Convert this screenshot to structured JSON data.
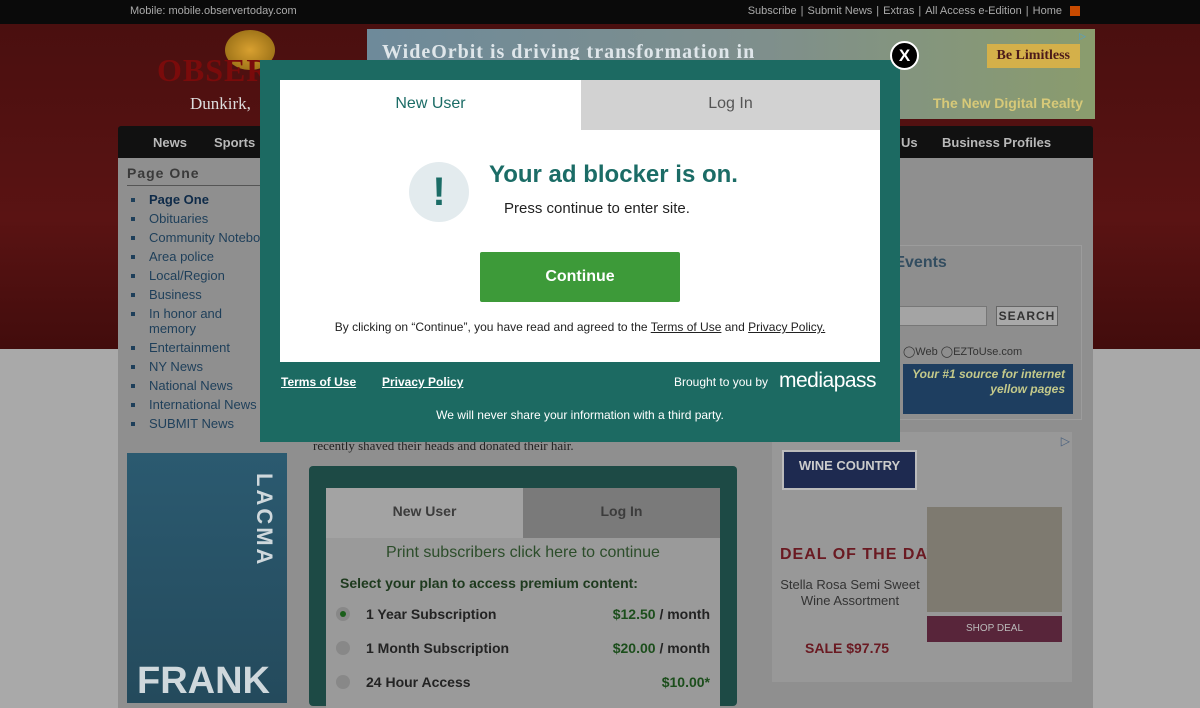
{
  "topbar": {
    "mobile": "Mobile: mobile.observertoday.com",
    "links": [
      "Subscribe",
      "|",
      "Submit News",
      "|",
      "Extras",
      "|",
      "All Access e-Edition",
      "|",
      "Home"
    ]
  },
  "logo": {
    "name": "OBSER",
    "city": "Dunkirk,"
  },
  "banner": {
    "headline": "WideOrbit is driving transformation in",
    "button": "Be Limitless",
    "tagline": "The New Digital Realty"
  },
  "nav": {
    "items": [
      "News",
      "Sports",
      "Us",
      "Business Profiles"
    ]
  },
  "sidebar": {
    "title": "Page One",
    "items": [
      "Page One",
      "Obituaries",
      "Community Notebook",
      "Area police",
      "Local/Region",
      "Business",
      "In honor and memory",
      "Entertainment",
      "NY News",
      "National News",
      "International News",
      "SUBMIT News"
    ]
  },
  "lacma": {
    "vertical": "LACMA",
    "bottom": "FRANK"
  },
  "article": {
    "snippet": "recently shaved their heads and donated their hair."
  },
  "paywall": {
    "tab_new": "New User",
    "tab_login": "Log In",
    "print_link": "Print subscribers click here to continue",
    "select_label": "Select your plan to access premium content:",
    "plans": [
      {
        "name": "1 Year Subscription",
        "price": "$12.50",
        "unit": " / month",
        "selected": true
      },
      {
        "name": "1 Month Subscription",
        "price": "$20.00",
        "unit": " / month",
        "selected": false
      },
      {
        "name": "24 Hour Access",
        "price": "$10.00*",
        "unit": "",
        "selected": false
      }
    ]
  },
  "events": {
    "title": "a Events",
    "search_btn": "SEARCH",
    "opts": "◯Web ◯EZToUse.com",
    "yp": "Your #1 source for internet yellow pages"
  },
  "wine": {
    "logo": "WINE COUNTRY",
    "deal": "DEAL OF THE DAY",
    "product": "Stella Rosa Semi Sweet Wine Assortment",
    "shop": "SHOP DEAL",
    "sale": "SALE $97.75"
  },
  "modal": {
    "tab_new": "New User",
    "tab_login": "Log In",
    "exclamation": "!",
    "headline": "Your ad blocker is on.",
    "subtext": "Press continue to enter site.",
    "continue_label": "Continue",
    "agree_prefix": "By clicking on “Continue”, you have read and agreed to the ",
    "agree_terms": "Terms of Use",
    "agree_and": " and ",
    "agree_privacy": "Privacy Policy.",
    "footer_terms": "Terms of Use",
    "footer_privacy": "Privacy Policy",
    "brought_by": "Brought to you by",
    "brand": "mediapass",
    "never_share": "We will never share your information with a third party.",
    "close": "X"
  },
  "colors": {
    "teal": "#1c6a62",
    "green": "#3d9a39",
    "tab_gray": "#d2d2d2"
  }
}
